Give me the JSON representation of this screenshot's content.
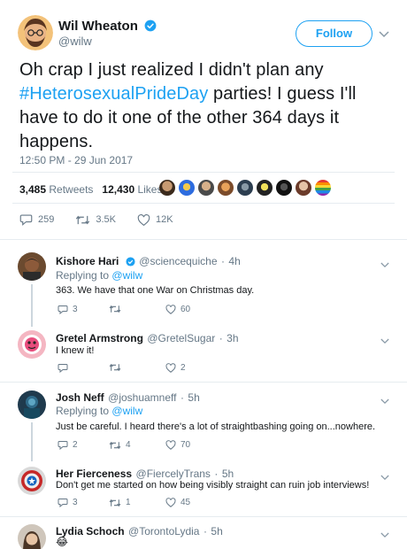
{
  "author": {
    "name": "Wil Wheaton",
    "handle": "@wilw",
    "verified": true
  },
  "follow_label": "Follow",
  "tweet": {
    "text_before": "Oh crap I just realized I didn't plan any",
    "hashtag": "#HeterosexualPrideDay",
    "text_after": " parties! I guess I'll have to do it one of the other 364 days it happens.",
    "timestamp": "12:50 PM - 29 Jun 2017",
    "retweets_count": "3,485",
    "retweets_label": "Retweets",
    "likes_count": "12,430",
    "likes_label": "Likes",
    "reply_count": "259",
    "retweet_count_short": "3.5K",
    "like_count_short": "12K"
  },
  "colors": {
    "accent": "#1da1f2",
    "muted": "#657786",
    "border": "#e6ecf0"
  },
  "replies": [
    {
      "name": "Kishore Hari",
      "verified": true,
      "handle": "@sciencequiche",
      "age": "4h",
      "replying_prefix": "Replying to",
      "replying_to": "@wilw",
      "text": "363. We have that one War on Christmas day.",
      "reply_count": "3",
      "retweet_count": "",
      "like_count": "60"
    },
    {
      "name": "Gretel Armstrong",
      "verified": false,
      "handle": "@GretelSugar",
      "age": "3h",
      "text": "I knew it!",
      "reply_count": "",
      "retweet_count": "",
      "like_count": "2"
    },
    {
      "name": "Josh Neff",
      "verified": false,
      "handle": "@joshuamneff",
      "age": "5h",
      "replying_prefix": "Replying to",
      "replying_to": "@wilw",
      "text": "Just be careful. I heard there's a lot of straightbashing going on...nowhere.",
      "reply_count": "2",
      "retweet_count": "4",
      "like_count": "70"
    },
    {
      "name": "Her Fierceness",
      "verified": false,
      "handle": "@FiercelyTrans",
      "age": "5h",
      "text": "Don't get me started on how being visibly straight can ruin job interviews!",
      "reply_count": "3",
      "retweet_count": "1",
      "like_count": "45"
    },
    {
      "name": "Lydia Schoch",
      "verified": false,
      "handle": "@TorontoLydia",
      "age": "5h",
      "text": "😂"
    }
  ],
  "icons": {
    "reply": "reply-icon",
    "retweet": "retweet-icon",
    "like": "heart-icon",
    "more": "chevron-down-icon",
    "verified": "verified-badge-icon"
  }
}
